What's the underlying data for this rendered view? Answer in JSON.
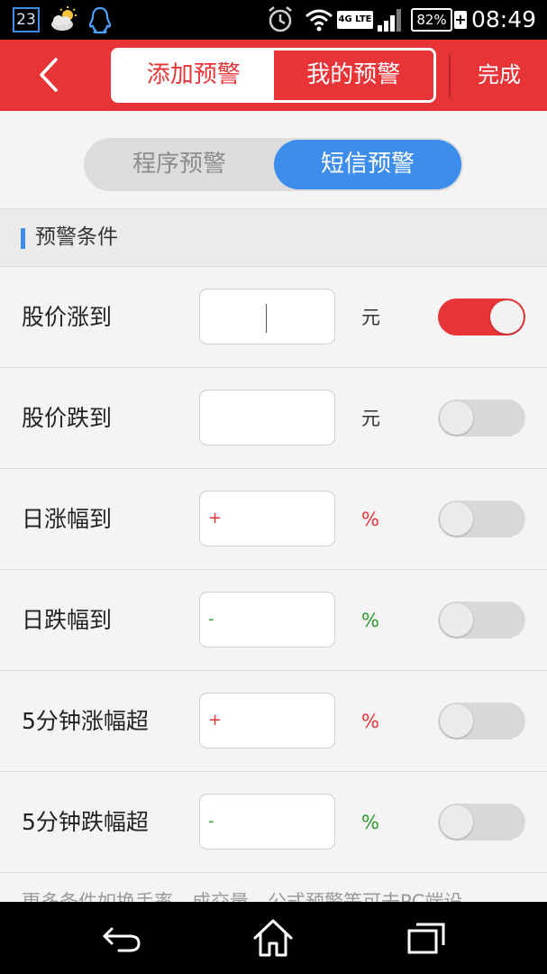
{
  "status_bar": {
    "notification_count": "23",
    "weather_icon": "partly-cloudy-icon",
    "app_icon": "qq-penguin-icon",
    "alarm_icon": "alarm-clock-icon",
    "wifi_icon": "wifi-icon",
    "network": "4G LTE",
    "signal_icon": "signal-bars-icon",
    "battery": "82%",
    "charging": "+",
    "time": "08:49"
  },
  "header": {
    "back_icon": "chevron-left-icon",
    "tabs": [
      {
        "label": "添加预警",
        "active": true
      },
      {
        "label": "我的预警",
        "active": false
      }
    ],
    "done_label": "完成"
  },
  "subtabs": [
    {
      "label": "程序预警",
      "active": false
    },
    {
      "label": "短信预警",
      "active": true
    }
  ],
  "section": {
    "title": "预警条件"
  },
  "conditions": [
    {
      "label": "股价涨到",
      "prefix": "",
      "unit": "元",
      "enabled": true
    },
    {
      "label": "股价跌到",
      "prefix": "",
      "unit": "元",
      "enabled": false
    },
    {
      "label": "日涨幅到",
      "prefix": "+",
      "unit": "%",
      "enabled": false
    },
    {
      "label": "日跌幅到",
      "prefix": "-",
      "unit": "%",
      "enabled": false
    },
    {
      "label": "5分钟涨幅超",
      "prefix": "+",
      "unit": "%",
      "enabled": false
    },
    {
      "label": "5分钟跌幅超",
      "prefix": "-",
      "unit": "%",
      "enabled": false
    }
  ],
  "footnote": "更多条件如换手率、成交量、公式预警等可去PC端设",
  "colors": {
    "brand_red": "#e83337",
    "accent_blue": "#3d8eec",
    "down_green": "#2b9a2b"
  },
  "nav_bar": {
    "back_icon": "back-arrow-icon",
    "home_icon": "home-icon",
    "recent_icon": "recent-apps-icon"
  }
}
